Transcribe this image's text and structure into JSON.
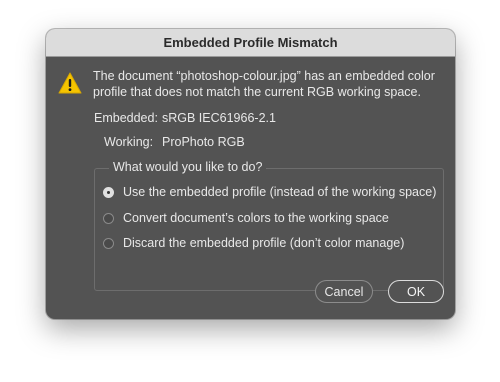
{
  "dialog": {
    "title": "Embedded Profile Mismatch",
    "message": "The document “photoshop-colour.jpg” has an embedded color profile that does not match the current RGB working space.",
    "embedded_label": "Embedded:",
    "embedded_value": "sRGB IEC61966-2.1",
    "working_label": "Working:",
    "working_value": "ProPhoto RGB",
    "question": "What would you like to do?",
    "options": [
      {
        "label": "Use the embedded profile (instead of the working space)",
        "selected": true
      },
      {
        "label": "Convert document’s colors to the working space",
        "selected": false
      },
      {
        "label": "Discard the embedded profile (don’t color manage)",
        "selected": false
      }
    ],
    "cancel_label": "Cancel",
    "ok_label": "OK"
  },
  "colors": {
    "dialog_bg": "#535353",
    "titlebar_bg": "#dcdcdc",
    "warning_yellow": "#f5c400",
    "text": "#e8e8e8"
  },
  "icons": {
    "warning": "warning-triangle-icon"
  }
}
